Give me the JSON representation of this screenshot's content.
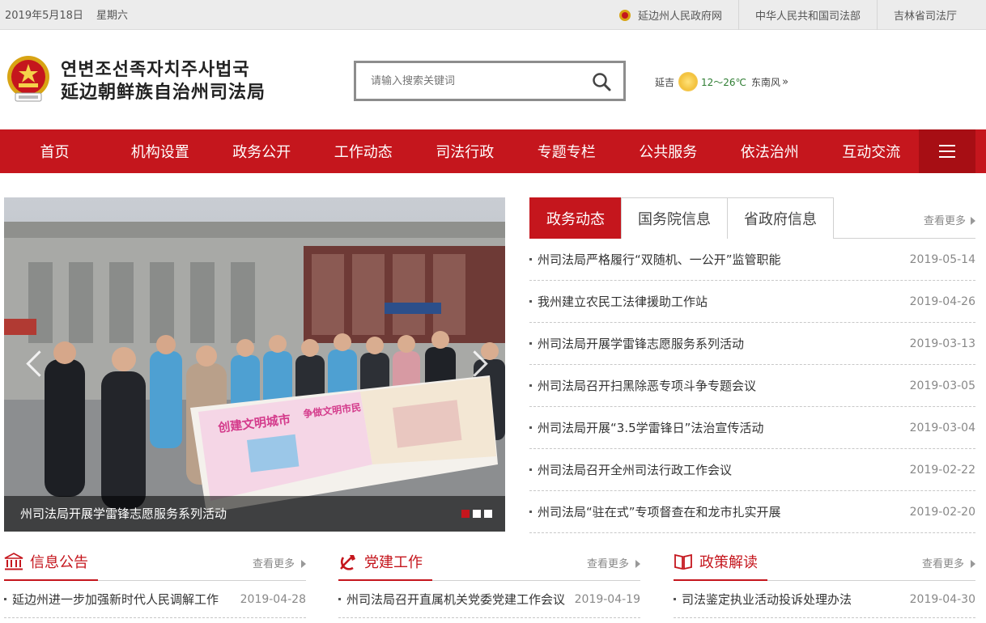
{
  "topbar": {
    "date": "2019年5月18日",
    "weekday": "星期六",
    "links": [
      "延边州人民政府网",
      "中华人民共和国司法部",
      "吉林省司法厅"
    ]
  },
  "header": {
    "logo_korean": "연변조선족자치주사법국",
    "logo_chinese": "延边朝鲜族自治州司法局",
    "search_placeholder": "请输入搜索关键词",
    "weather": {
      "city": "延吉",
      "temp": "12～26℃",
      "wind": "东南风",
      "more": "»"
    }
  },
  "nav": {
    "items": [
      "首页",
      "机构设置",
      "政务公开",
      "工作动态",
      "司法行政",
      "专题专栏",
      "公共服务",
      "依法治州",
      "互动交流"
    ]
  },
  "slider": {
    "caption": "州司法局开展学雷锋志愿服务系列活动",
    "banner_left": "创建文明城市",
    "banner_right": "争做文明市民"
  },
  "news": {
    "tabs": [
      "政务动态",
      "国务院信息",
      "省政府信息"
    ],
    "more": "查看更多",
    "items": [
      {
        "title": "州司法局严格履行“双随机、一公开”监管职能",
        "date": "2019-05-14"
      },
      {
        "title": "我州建立农民工法律援助工作站",
        "date": "2019-04-26"
      },
      {
        "title": "州司法局开展学雷锋志愿服务系列活动",
        "date": "2019-03-13"
      },
      {
        "title": "州司法局召开扫黑除恶专项斗争专题会议",
        "date": "2019-03-05"
      },
      {
        "title": "州司法局开展“3.5学雷锋日”法治宣传活动",
        "date": "2019-03-04"
      },
      {
        "title": "州司法局召开全州司法行政工作会议",
        "date": "2019-02-22"
      },
      {
        "title": "州司法局“驻在式”专项督查在和龙市扎实开展",
        "date": "2019-02-20"
      }
    ]
  },
  "panels": [
    {
      "title": "信息公告",
      "more": "查看更多",
      "item": {
        "title": "延边州进一步加强新时代人民调解工作",
        "date": "2019-04-28"
      }
    },
    {
      "title": "党建工作",
      "more": "查看更多",
      "item": {
        "title": "州司法局召开直属机关党委党建工作会议",
        "date": "2019-04-19"
      }
    },
    {
      "title": "政策解读",
      "more": "查看更多",
      "item": {
        "title": "司法鉴定执业活动投诉处理办法",
        "date": "2019-04-30"
      }
    }
  ],
  "colors": {
    "brand_red": "#c5161d",
    "nav_dark_red": "#a70e14"
  }
}
